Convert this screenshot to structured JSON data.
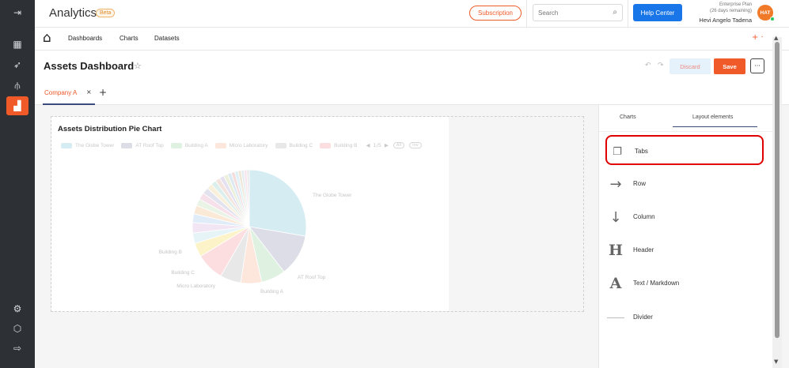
{
  "header": {
    "app_title": "Analytics",
    "beta_badge": "Beta",
    "subscription_label": "Subscription",
    "search_placeholder": "Search",
    "help_label": "Help Center",
    "plan_line1": "Enterprise Plan",
    "plan_line2": "(26 days remaining)",
    "user_name": "Hevi Angelo Tadena",
    "avatar_initials": "HAT"
  },
  "nav": {
    "links": [
      "Dashboards",
      "Charts",
      "Datasets"
    ],
    "add_symbol": "+ ·"
  },
  "dashboard": {
    "title": "Assets Dashboard",
    "discard_label": "Discard",
    "save_label": "Save",
    "more_symbol": "···"
  },
  "tabs": {
    "active_label": "Company A",
    "close_symbol": "×",
    "add_symbol": "+"
  },
  "chart_data": {
    "type": "pie",
    "title": "Assets Distribution Pie Chart",
    "legend_placement": "top-left",
    "legend": [
      "The Globe Tower",
      "AT Roof Top",
      "Building A",
      "Micro Laboratory",
      "Building C",
      "Building B"
    ],
    "legend_page": "1/5",
    "legend_buttons": [
      "All",
      "Inv"
    ],
    "slice_labels": [
      "The Globe Tower",
      "AT Roof Top",
      "Building A",
      "Micro Laboratory",
      "Building C",
      "Building B"
    ],
    "slices": [
      {
        "label": "The Globe Tower",
        "value": 28,
        "color": "#d6ecf3"
      },
      {
        "label": "AT Roof Top",
        "value": 12,
        "color": "#dcdde6"
      },
      {
        "label": "Building A",
        "value": 7,
        "color": "#dff2e2"
      },
      {
        "label": "Micro Laboratory",
        "value": 6,
        "color": "#fde6dc"
      },
      {
        "label": "Building C",
        "value": 6,
        "color": "#e8e8e8"
      },
      {
        "label": "Building B",
        "value": 8,
        "color": "#fcdde0"
      },
      {
        "value": 4,
        "color": "#fdf3c8"
      },
      {
        "value": 3,
        "color": "#e6f4f8"
      },
      {
        "value": 3,
        "color": "#f2e6f4"
      },
      {
        "value": 2.5,
        "color": "#e0ecf8"
      },
      {
        "value": 2.5,
        "color": "#fbe9d7"
      },
      {
        "value": 2,
        "color": "#e9f3e6"
      },
      {
        "value": 2,
        "color": "#f6e0e9"
      },
      {
        "value": 1.8,
        "color": "#e3e3ef"
      },
      {
        "value": 1.6,
        "color": "#f9f0dc"
      },
      {
        "value": 1.5,
        "color": "#dcefec"
      },
      {
        "value": 1.4,
        "color": "#f3e3dc"
      },
      {
        "value": 1.3,
        "color": "#e6e1f1"
      },
      {
        "value": 1.2,
        "color": "#eaf0d9"
      },
      {
        "value": 1.1,
        "color": "#dde9f2"
      },
      {
        "value": 1,
        "color": "#f4dcdc"
      },
      {
        "value": 1,
        "color": "#dff0f6"
      },
      {
        "value": 0.9,
        "color": "#efe7d8"
      },
      {
        "value": 0.8,
        "color": "#e4eef0"
      },
      {
        "value": 0.8,
        "color": "#f7e4ef"
      },
      {
        "value": 0.7,
        "color": "#e9e9e9"
      }
    ]
  },
  "panel": {
    "tabs": [
      "Charts",
      "Layout elements"
    ],
    "items": [
      {
        "label": "Tabs",
        "icon": "tabs-icon",
        "glyph": "❐"
      },
      {
        "label": "Row",
        "icon": "arrow-right-icon",
        "glyph": "→"
      },
      {
        "label": "Column",
        "icon": "arrow-down-icon",
        "glyph": "↓"
      },
      {
        "label": "Header",
        "icon": "header-icon",
        "glyph": "H"
      },
      {
        "label": "Text / Markdown",
        "icon": "text-icon",
        "glyph": "A"
      },
      {
        "label": "Divider",
        "icon": "divider-icon",
        "glyph": ""
      }
    ]
  },
  "colors": {
    "accent": "#f05a28",
    "primary_blue": "#1976e8",
    "rail_bg": "#2d3035",
    "highlight": "#e00000"
  }
}
